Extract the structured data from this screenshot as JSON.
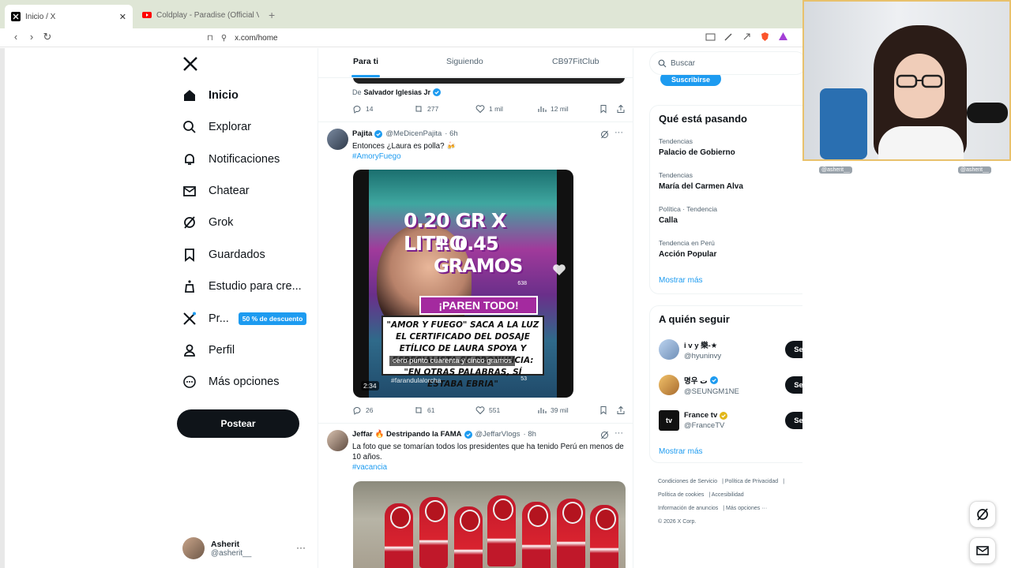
{
  "browser": {
    "tabs": [
      {
        "title": "Inicio / X",
        "active": true,
        "favicon": "x-logo-icon"
      },
      {
        "title": "Coldplay - Paradise (Official Video) -",
        "active": false,
        "favicon": "youtube-icon"
      }
    ],
    "url": "x.com/home"
  },
  "nav": {
    "items": [
      {
        "label": "Inicio",
        "icon": "home-icon"
      },
      {
        "label": "Explorar",
        "icon": "search-icon"
      },
      {
        "label": "Notificaciones",
        "icon": "bell-icon"
      },
      {
        "label": "Chatear",
        "icon": "mail-icon"
      },
      {
        "label": "Grok",
        "icon": "grok-icon"
      },
      {
        "label": "Guardados",
        "icon": "bookmark-icon"
      },
      {
        "label": "Estudio para cre...",
        "icon": "studio-icon"
      },
      {
        "label": "Pr...",
        "icon": "x-premium-icon",
        "badge": "50 % de descuento"
      },
      {
        "label": "Perfil",
        "icon": "person-icon"
      },
      {
        "label": "Más opciones",
        "icon": "more-circle-icon"
      }
    ],
    "post_button": "Postear",
    "user": {
      "name": "Asherit",
      "handle": "@asherit__"
    }
  },
  "feed": {
    "tabs": [
      "Para ti",
      "Siguiendo",
      "CB97FitClub"
    ],
    "prev_post": {
      "via_prefix": "De",
      "via_name": "Salvador Iglesias Jr",
      "replies": "14",
      "reposts": "277",
      "likes": "1 mil",
      "views": "12 mil"
    },
    "post1": {
      "name": "Pajita",
      "handle": "@MeDicenPajita",
      "time": "· 6h",
      "text": "Entonces ¿Laura es polla? 🍻",
      "hashtag": "#AmoryFuego",
      "video": {
        "line1": "0.20 GR X LITRO",
        "line2": "+ 0.45 GRAMOS",
        "paren": "¡PAREN TODO!",
        "box": "\"AMOR Y FUEGO\" SACA A LA LUZ EL CERTIFICADO DEL DOSAJE ETÍLICO DE LAURA SPOYA Y ESPECIALISTA SE PRONUNCIA: \"EN OTRAS PALABRAS, SÍ ESTABA EBRIA\"",
        "caption": "cero punto cuarenta y cinco gramos",
        "tag": "#farandulalorcha",
        "duration": "2:34",
        "count1": "638",
        "count2": "53"
      },
      "replies": "26",
      "reposts": "61",
      "likes": "551",
      "views": "39 mil"
    },
    "post2": {
      "name": "Jeffar 🔥 Destripando la FAMA",
      "handle": "@JeffarVlogs",
      "time": "· 8h",
      "text": "La foto que se tomarían todos los presidentes que ha tenido Perú en menos de 10 años.",
      "hashtag": "#vacancia"
    }
  },
  "sidebar": {
    "search_placeholder": "Buscar",
    "subscribe": "Suscribirse",
    "trends_title": "Qué está pasando",
    "trends": [
      {
        "context": "Tendencias",
        "title": "Palacio de Gobierno",
        "more": false
      },
      {
        "context": "Tendencias",
        "title": "María del Carmen Alva",
        "more": true
      },
      {
        "context": "Política · Tendencia",
        "title": "Calla",
        "more": true
      },
      {
        "context": "Tendencia en Perú",
        "title": "Acción Popular",
        "more": true
      }
    ],
    "show_more": "Mostrar más",
    "follow_title": "A quién seguir",
    "follow": [
      {
        "name": "i v y 樂-★",
        "handle": "@hyuninvy",
        "button": "Seguir"
      },
      {
        "name": "명우 ت",
        "handle": "@SEUNGM1NE",
        "button": "Seguir"
      },
      {
        "name": "France tv",
        "handle": "@FranceTV",
        "button": "Seguir"
      }
    ],
    "show_more_2": "Mostrar más",
    "footer": [
      "Condiciones de Servicio",
      "Política de Privacidad",
      "Política de cookies",
      "Accesibilidad",
      "Información de anuncios",
      "Más opciones ···",
      "© 2026 X Corp."
    ]
  },
  "overlay": {
    "chat_tags": [
      "@asherit__",
      "@asherit__"
    ]
  },
  "colors": {
    "accent": "#1d9bf0",
    "text": "#0f1419",
    "muted": "#536471"
  }
}
